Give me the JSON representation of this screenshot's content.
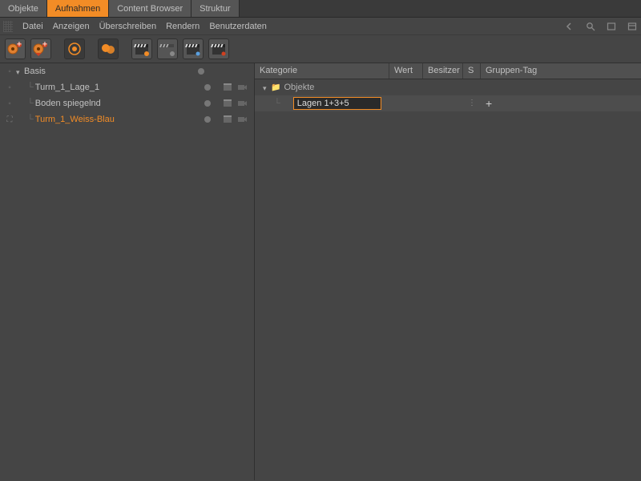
{
  "topTabs": {
    "items": [
      {
        "label": "Objekte"
      },
      {
        "label": "Aufnahmen"
      },
      {
        "label": "Content Browser"
      },
      {
        "label": "Struktur"
      }
    ],
    "activeIndex": 1
  },
  "menus": {
    "items": [
      {
        "label": "Datei"
      },
      {
        "label": "Anzeigen"
      },
      {
        "label": "Überschreiben"
      },
      {
        "label": "Rendern"
      },
      {
        "label": "Benutzerdaten"
      }
    ]
  },
  "tree": {
    "root": {
      "label": "Basis",
      "children": [
        {
          "label": "Turm_1_Lage_1",
          "selected": false
        },
        {
          "label": "Boden spiegelnd",
          "selected": false
        },
        {
          "label": "Turm_1_Weiss-Blau",
          "selected": true
        }
      ]
    }
  },
  "rightHeaders": {
    "kategorie": "Kategorie",
    "wert": "Wert",
    "besitzer": "Besitzer",
    "s": "S",
    "gruppenTag": "Gruppen-Tag"
  },
  "attrTree": {
    "root": {
      "label": "Objekte"
    },
    "editing": {
      "value": "Lagen 1+3+5"
    }
  },
  "icons": {
    "plus": "+"
  },
  "colors": {
    "accent": "#f28c26"
  }
}
